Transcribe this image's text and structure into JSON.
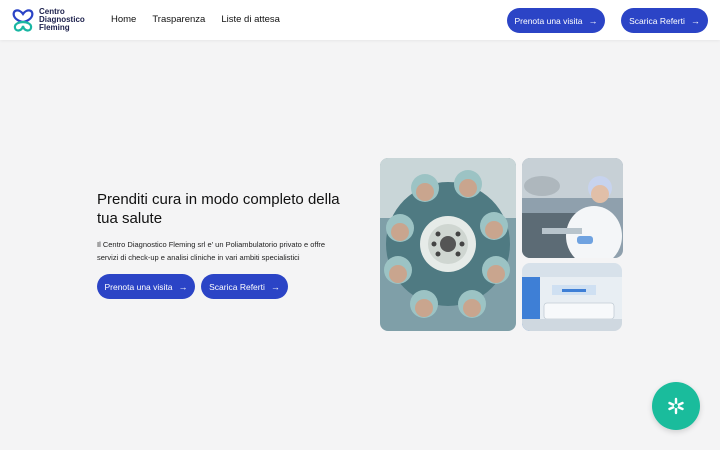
{
  "brand": {
    "name_line1": "Centro",
    "name_line2": "Diagnostico",
    "name_line3": "Fleming"
  },
  "nav": [
    {
      "label": "Home"
    },
    {
      "label": "Trasparenza"
    },
    {
      "label": "Liste di attesa"
    }
  ],
  "header_buttons": {
    "book_label": "Prenota una visita",
    "report_label": "Scarica Referti"
  },
  "hero": {
    "title": "Prenditi cura in modo completo della tua salute",
    "text": "Il Centro Diagnostico Fleming srl e' un Poliambulatorio privato e offre servizi di check-up e analisi cliniche in vari ambiti specialistici",
    "book_label": "Prenota una visita",
    "report_label": "Scarica Referti"
  },
  "icons": {
    "arrow": "arrow-right-icon",
    "logo": "fleming-logo-icon",
    "fab": "accessibility-icon"
  },
  "colors": {
    "accent": "#2b44c6",
    "fab": "#1abc9c",
    "background": "#f4f4f5"
  }
}
